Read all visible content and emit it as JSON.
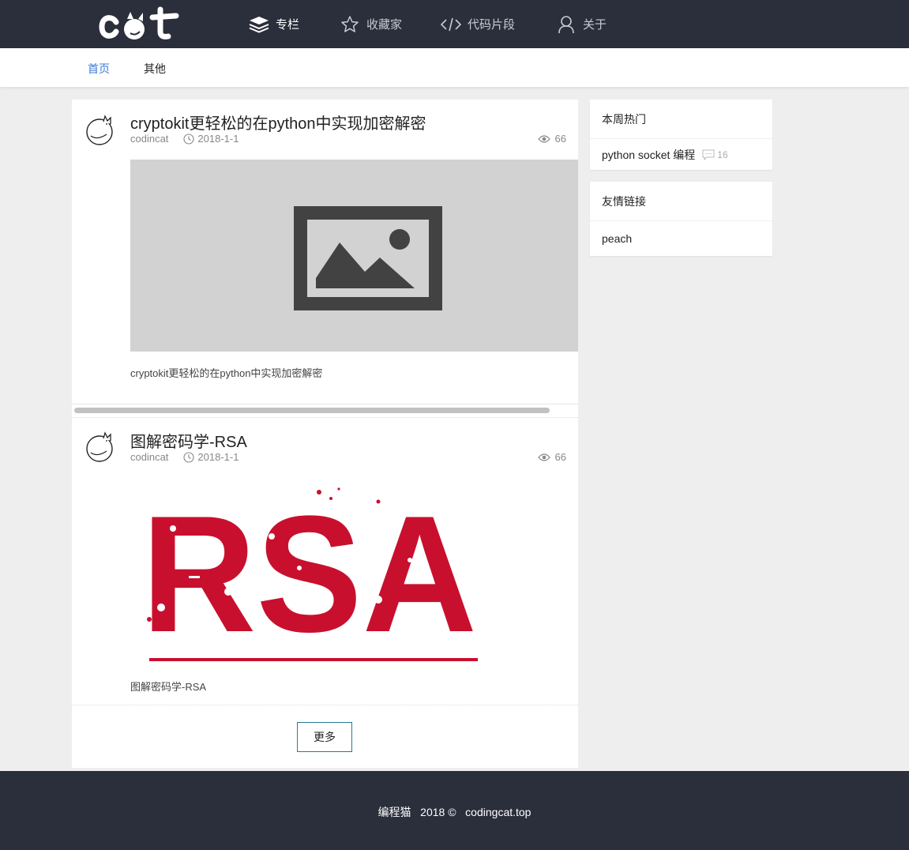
{
  "header": {
    "logo_text": "cat",
    "nav": [
      {
        "label": "专栏",
        "icon": "layers-icon",
        "active": true
      },
      {
        "label": "收藏家",
        "icon": "star-icon",
        "active": false
      },
      {
        "label": "代码片段",
        "icon": "code-icon",
        "active": false
      },
      {
        "label": "关于",
        "icon": "user-icon",
        "active": false
      }
    ],
    "bg_color": "#2b2e3b"
  },
  "subnav": {
    "items": [
      {
        "label": "首页",
        "active": true
      },
      {
        "label": "其他",
        "active": false
      }
    ],
    "active_color": "#3a7bd5"
  },
  "posts": [
    {
      "title": "cryptokit更轻松的在python中实现加密解密",
      "author": "codincat",
      "date": "2018-1-1",
      "views": "66",
      "excerpt": "cryptokit更轻松的在python中实现加密解密",
      "image": "placeholder-image"
    },
    {
      "title": "图解密码学-RSA",
      "author": "codincat",
      "date": "2018-1-1",
      "views": "66",
      "excerpt": "图解密码学-RSA",
      "image": "rsa-logo-image",
      "image_text": "RSA"
    }
  ],
  "more_button": "更多",
  "sidebar": {
    "hot": {
      "title": "本周热门",
      "items": [
        {
          "label": "python socket 编程",
          "comments": "16"
        }
      ]
    },
    "links": {
      "title": "友情链接",
      "items": [
        {
          "label": "peach"
        }
      ]
    }
  },
  "footer": {
    "text": "编程猫   2018 ©   codingcat.top"
  },
  "colors": {
    "accent": "#3a7bd5",
    "rsa_red": "#c8102e",
    "button_border": "#2a7b8c"
  }
}
